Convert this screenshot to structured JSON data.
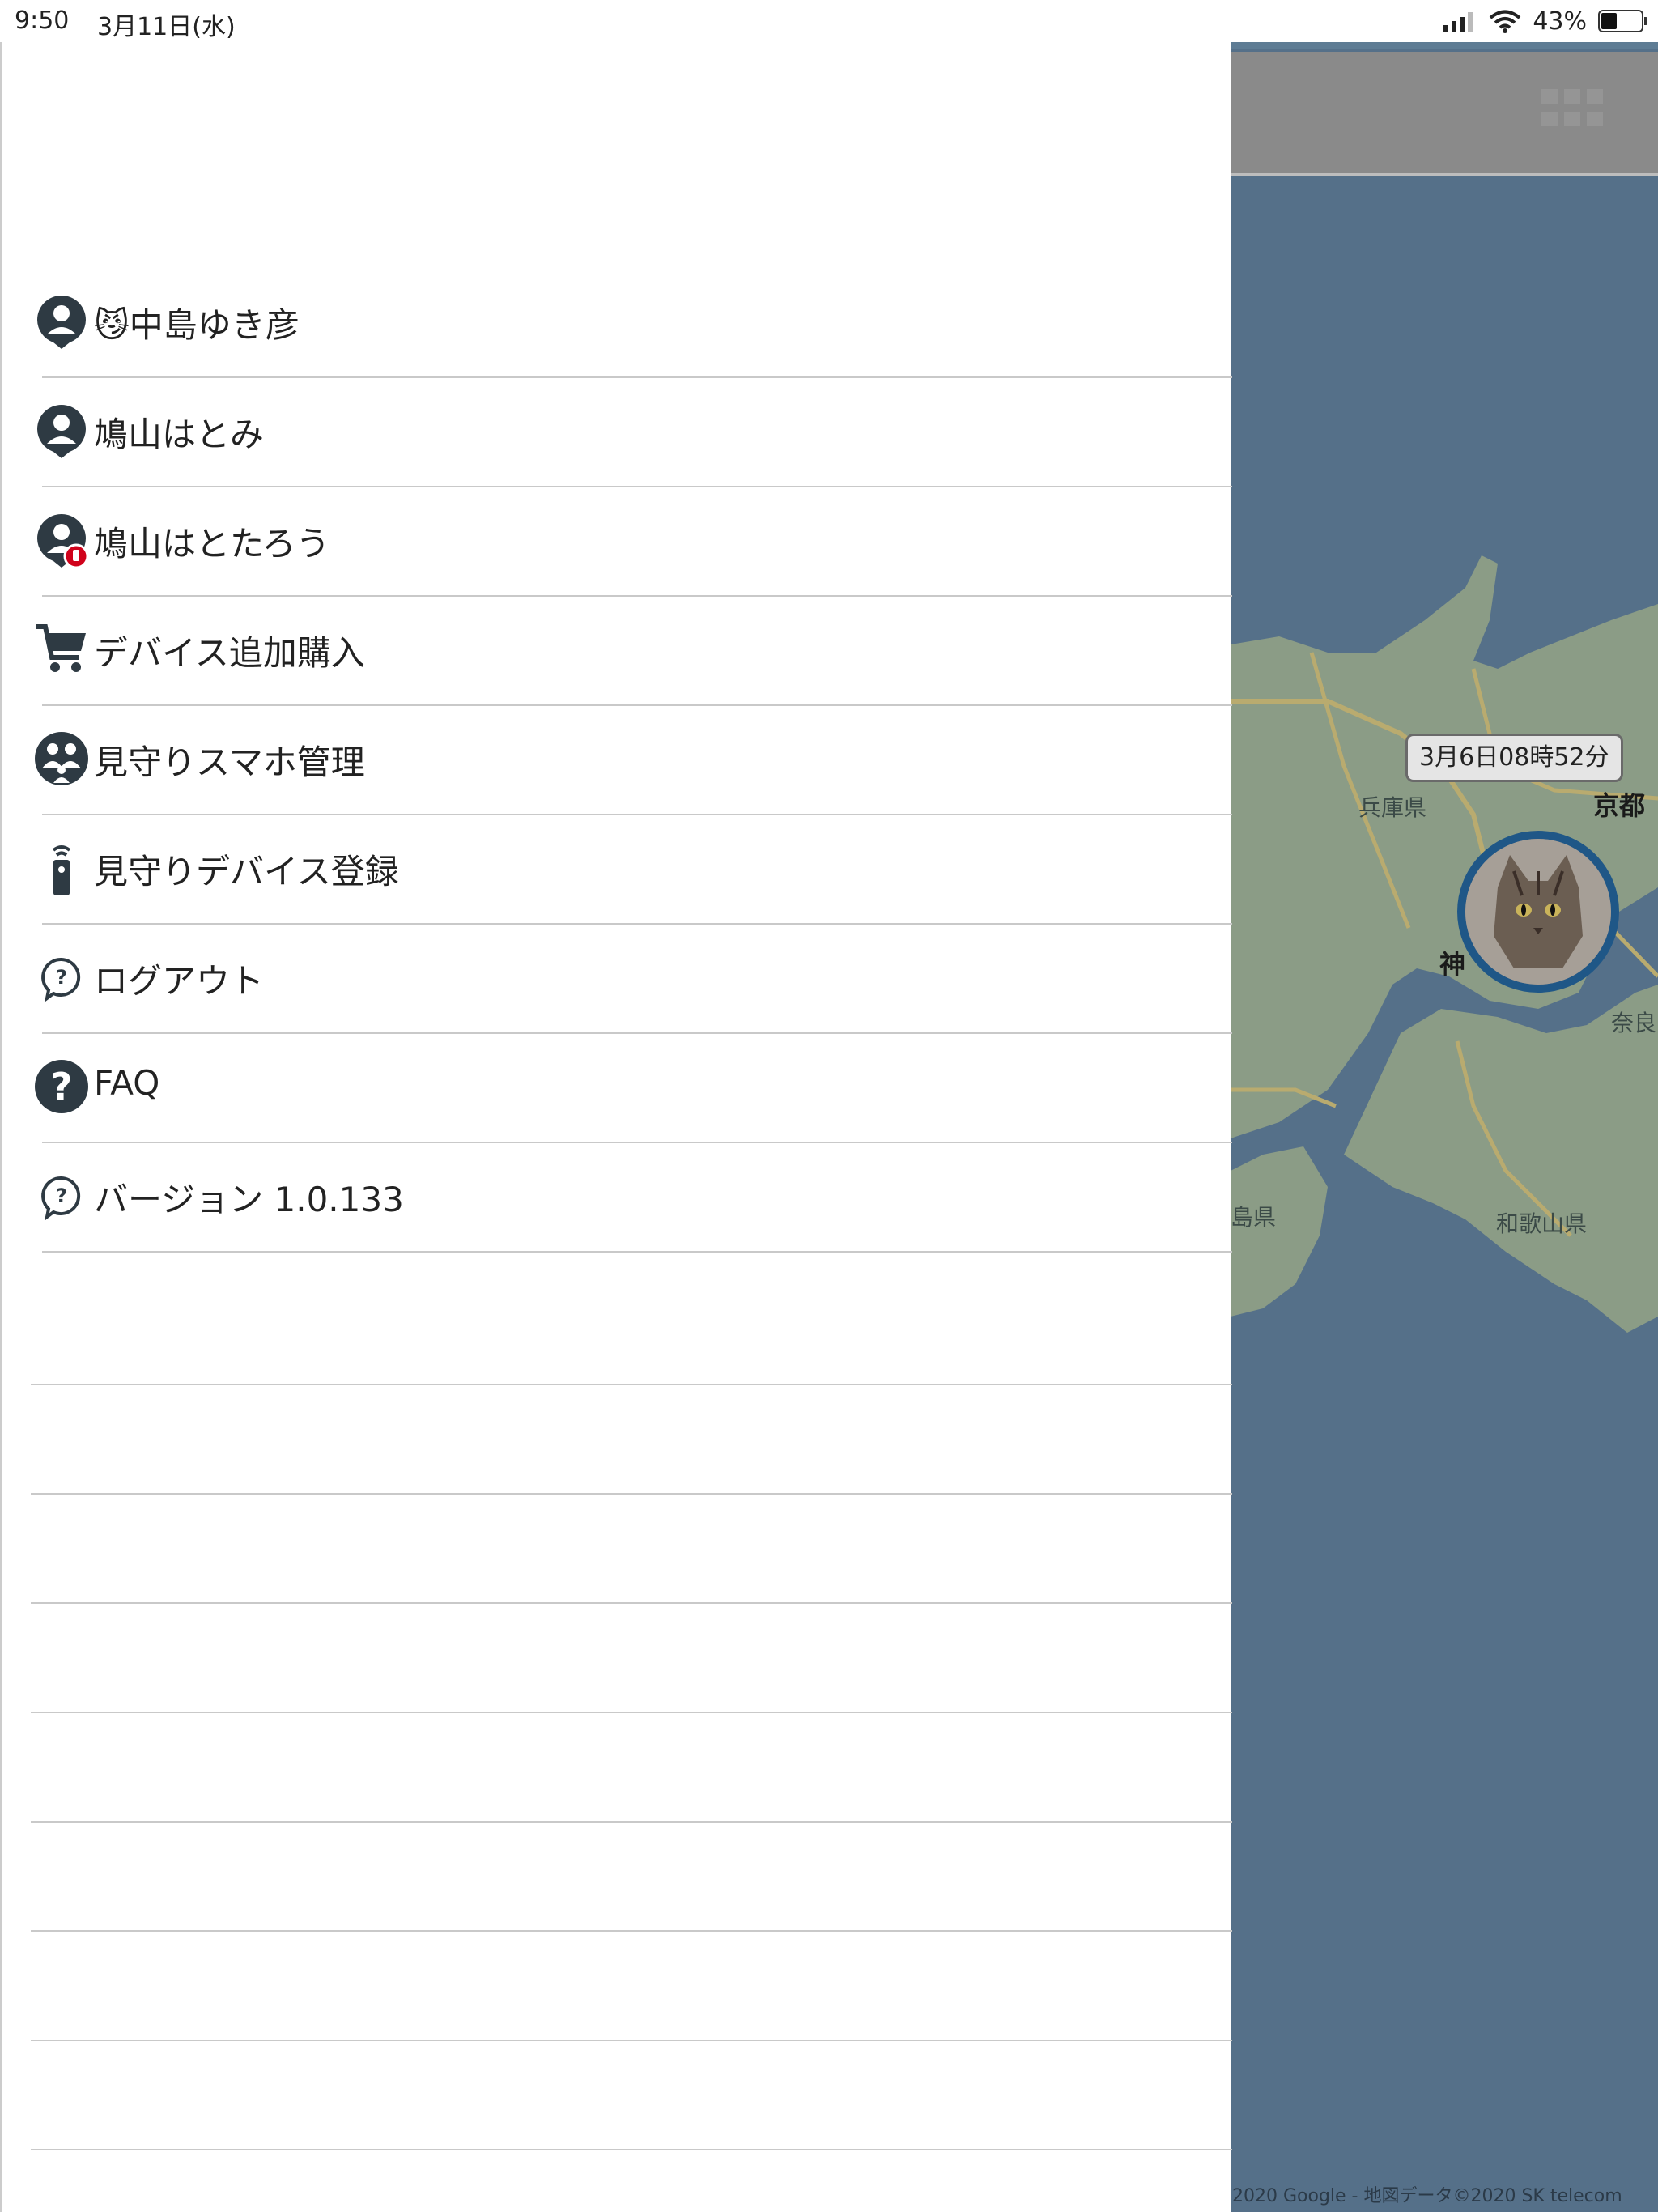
{
  "status_bar": {
    "time": "9:50",
    "date": "3月11日(水)",
    "battery_text": "43%",
    "battery_level": 0.43
  },
  "menu": [
    {
      "icon": "person-pin-icon",
      "label": "😼中島ゆき彦"
    },
    {
      "icon": "person-pin-icon",
      "label": "鳩山はとみ"
    },
    {
      "icon": "person-pin-alert-icon",
      "label": "鳩山はとたろう"
    },
    {
      "icon": "cart-icon",
      "label": "デバイス追加購入"
    },
    {
      "icon": "family-icon",
      "label": "見守りスマホ管理"
    },
    {
      "icon": "remote-device-icon",
      "label": "見守りデバイス登録"
    },
    {
      "icon": "help-bubble-icon",
      "label": "ログアウト"
    },
    {
      "icon": "help-circle-icon",
      "label": "FAQ"
    },
    {
      "icon": "help-bubble-icon",
      "label": "バージョン 1.0.133"
    }
  ],
  "map": {
    "time_label": "3月6日08時52分",
    "places": {
      "hyogo": "兵庫県",
      "kyoto": "京都",
      "kobe": "神",
      "nara": "奈良",
      "wakayama": "和歌山県",
      "tokushima": "島県"
    },
    "credit": "2020 Google - 地図データ©2020 SK telecom"
  },
  "colors": {
    "icon": "#2e3a43",
    "map_water": "#557089",
    "marker_ring": "#1f5787",
    "alert_badge": "#d0021b"
  }
}
